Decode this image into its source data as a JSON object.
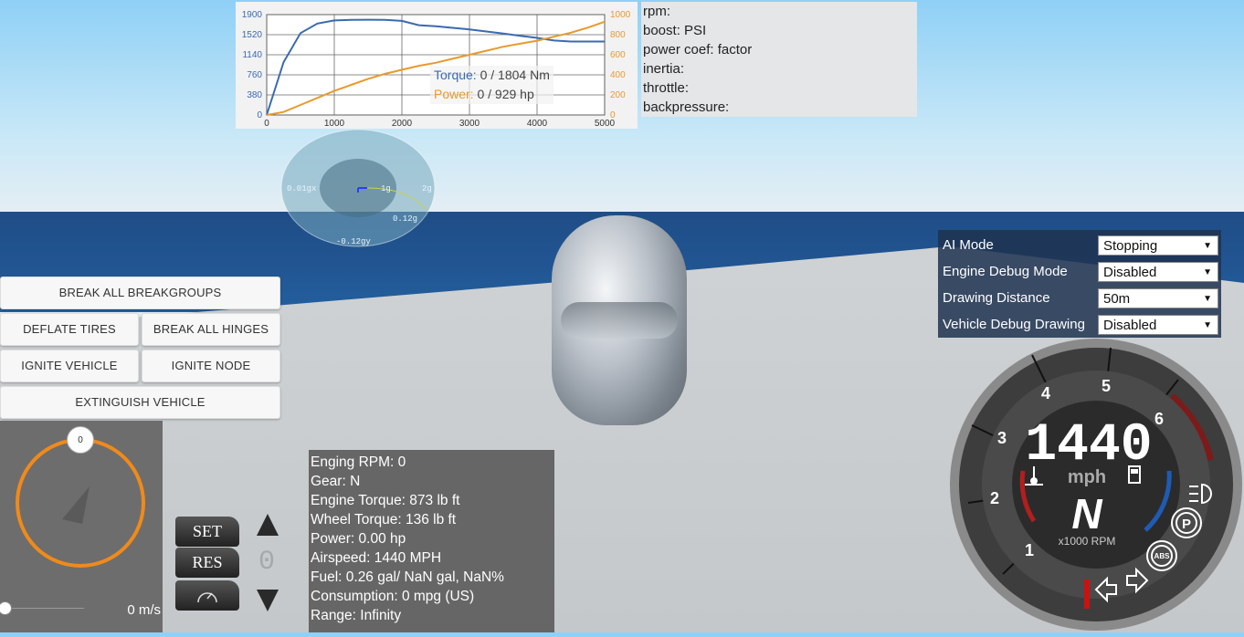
{
  "chart": {
    "left_ticks": [
      "1900",
      "1520",
      "1140",
      "760",
      "380",
      "0"
    ],
    "right_ticks": [
      "1000",
      "800",
      "600",
      "400",
      "200",
      "0"
    ],
    "x_ticks": [
      "0",
      "1000",
      "2000",
      "3000",
      "4000",
      "5000"
    ],
    "torque_label": "Torque:",
    "torque_value": "0 / 1804 Nm",
    "power_label": "Power:",
    "power_value": "0 / 929 hp",
    "colors": {
      "torque": "#3a6ab0",
      "power": "#e89a2c"
    }
  },
  "chart_data": {
    "type": "line",
    "x": [
      0,
      250,
      500,
      750,
      1000,
      1250,
      1500,
      1750,
      2000,
      2250,
      2500,
      2750,
      3000,
      3250,
      3500,
      3750,
      4000,
      4250,
      4500,
      4750,
      5000
    ],
    "series": [
      {
        "name": "Torque",
        "axis": "left",
        "values": [
          0,
          1000,
          1550,
          1730,
          1790,
          1800,
          1804,
          1800,
          1780,
          1700,
          1680,
          1650,
          1620,
          1580,
          1540,
          1500,
          1460,
          1410,
          1390,
          1390,
          1390
        ]
      },
      {
        "name": "Power",
        "axis": "right",
        "values": [
          0,
          30,
          100,
          170,
          240,
          300,
          360,
          410,
          450,
          490,
          520,
          560,
          600,
          640,
          680,
          710,
          740,
          780,
          820,
          870,
          929
        ]
      }
    ],
    "left_ylim": [
      0,
      1900
    ],
    "right_ylim": [
      0,
      1000
    ],
    "xlim": [
      0,
      5000
    ]
  },
  "info": {
    "lines": [
      "rpm:",
      "boost: PSI",
      "power coef: factor",
      "inertia:",
      "throttle:",
      "backpressure:"
    ]
  },
  "gforce": {
    "left_label": "0.01gx",
    "ring1": "1g",
    "ring2": "2g",
    "right_value": "0.12g",
    "bottom_label": "-0.12gy"
  },
  "buttons": {
    "break_all_breakgroups": "BREAK ALL BREAKGROUPS",
    "deflate_tires": "DEFLATE TIRES",
    "break_all_hinges": "BREAK ALL HINGES",
    "ignite_vehicle": "IGNITE VEHICLE",
    "ignite_node": "IGNITE NODE",
    "extinguish_vehicle": "EXTINGUISH VEHICLE"
  },
  "steering": {
    "knob_value": "0",
    "speed": "0 m/s"
  },
  "cruise": {
    "set": "SET",
    "res": "RES",
    "display": "0"
  },
  "telemetry": {
    "lines": [
      "Enging RPM: 0",
      "Gear: N",
      "Engine Torque: 873 lb ft",
      "Wheel Torque: 136 lb ft",
      "Power: 0.00 hp",
      "Airspeed: 1440 MPH",
      "Fuel: 0.26 gal/ NaN gal, NaN%",
      "Consumption: 0 mpg (US)",
      "Range: Infinity"
    ]
  },
  "debug": {
    "rows": [
      {
        "label": "AI Mode",
        "value": "Stopping"
      },
      {
        "label": "Engine Debug Mode",
        "value": "Disabled"
      },
      {
        "label": "Drawing Distance",
        "value": "50m"
      },
      {
        "label": "Vehicle Debug Drawing",
        "value": "Disabled"
      }
    ]
  },
  "gauge": {
    "speed": "1440",
    "unit": "mph",
    "gear": "N",
    "rpm_label": "x1000 RPM",
    "tick_labels": [
      "1",
      "2",
      "3",
      "4",
      "5",
      "6"
    ],
    "abs": "ABS",
    "parking": "P"
  }
}
